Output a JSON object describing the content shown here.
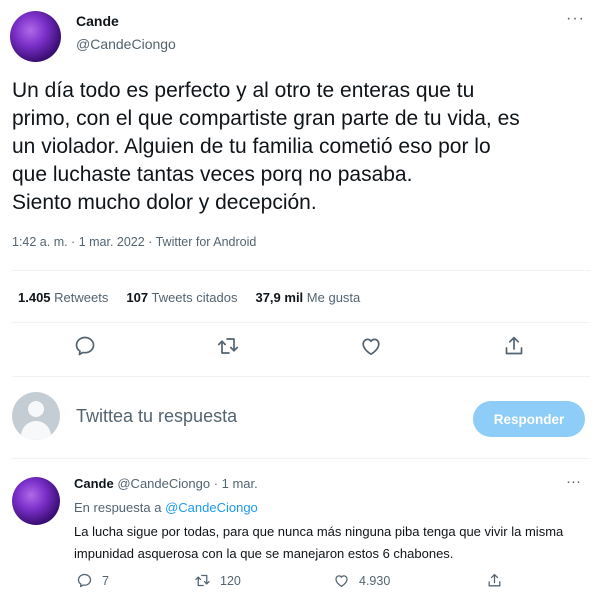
{
  "tweet": {
    "author_name": "Cande",
    "author_handle": "@CandeCiongo",
    "more_label": "···",
    "text": "Un día todo es perfecto y al otro te enteras que tu\nprimo, con el que compartiste gran parte de tu vida, es\nun violador. Alguien de tu familia cometió eso por lo\nque luchaste tantas veces porq no pasaba.\nSiento mucho dolor y decepción.",
    "meta": "1:42 a. m. · 1 mar. 2022 · Twitter for Android",
    "stats": {
      "retweets_count": "1.405",
      "retweets_label": "Retweets",
      "quotes_count": "107",
      "quotes_label": "Tweets citados",
      "likes_count": "37,9 mil",
      "likes_label": "Me gusta"
    },
    "actions": [
      "reply-icon",
      "retweet-icon",
      "like-icon",
      "share-icon"
    ]
  },
  "composer": {
    "placeholder": "Twittea tu respuesta",
    "button_label": "Responder"
  },
  "reply": {
    "author_name": "Cande",
    "author_handle": "@CandeCiongo",
    "date": "· 1 mar.",
    "more_label": "···",
    "reply_to_prefix": "En respuesta a",
    "reply_to_handle": "@CandeCiongo",
    "text": "La lucha sigue por todas, para que nunca más ninguna piba tenga que vivir la misma impunidad asquerosa con la que se manejaron estos 6 chabones.",
    "counts": {
      "replies": "7",
      "retweets": "120",
      "likes": "4.930"
    }
  },
  "colors": {
    "accent": "#1d9bf0",
    "button_disabled": "#8ecdf8",
    "secondary_text": "#536471",
    "divider": "#eff3f4"
  }
}
